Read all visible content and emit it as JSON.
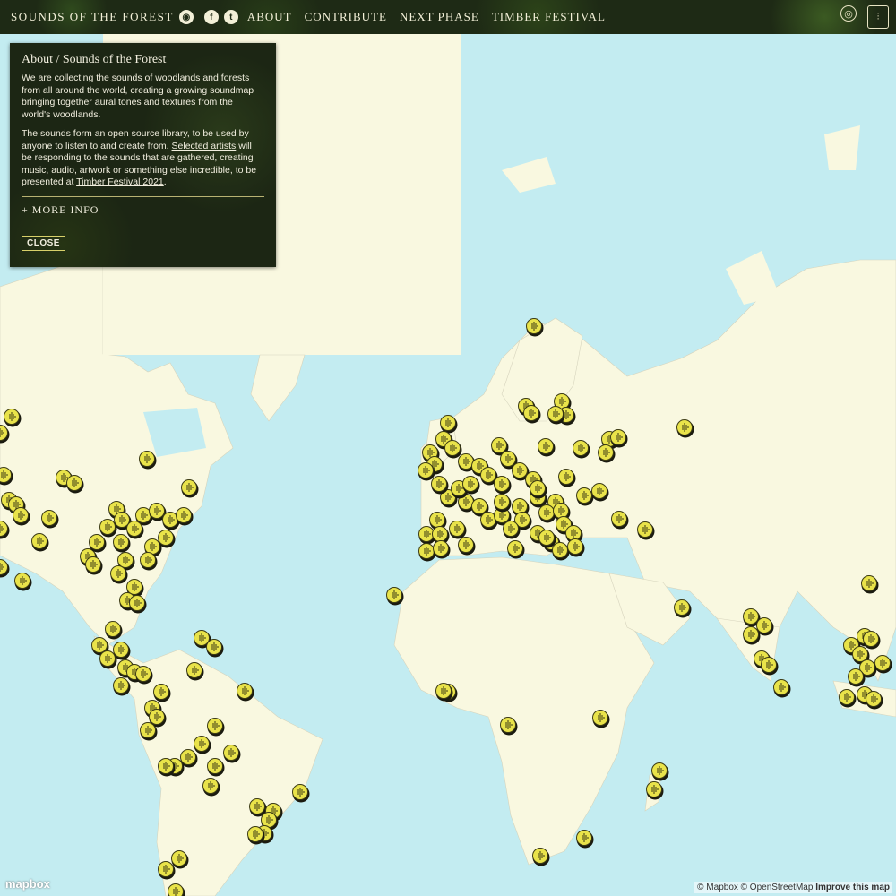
{
  "header": {
    "brand": "SOUNDS OF THE FOREST",
    "nav": [
      "ABOUT",
      "CONTRIBUTE",
      "NEXT PHASE",
      "TIMBER FESTIVAL"
    ],
    "icons": [
      "sound-icon",
      "facebook-icon",
      "twitter-icon",
      "lock-icon",
      "forest-icon"
    ]
  },
  "panel": {
    "title": "About / Sounds of the Forest",
    "para1": "We are collecting the sounds of woodlands and forests from all around the world, creating a growing soundmap bringing together aural tones and textures from the world's woodlands.",
    "para2_a": "The sounds form an open source library, to be used by anyone to listen to and create from. ",
    "para2_link1": "Selected artists",
    "para2_b": " will be responding to the sounds that are gathered, creating music, audio, artwork or something else incredible, to be presented at ",
    "para2_link2": "Timber Festival 2021",
    "para2_c": ".",
    "more": "+ MORE INFO",
    "close": "CLOSE"
  },
  "map": {
    "attribution_a": "© Mapbox © OpenStreetMap ",
    "attribution_b": "Improve this map",
    "logo": "mapbox"
  },
  "colors": {
    "water": "#c3ecf1",
    "land": "#f9f8e0",
    "marker": "#e9e34a"
  }
}
